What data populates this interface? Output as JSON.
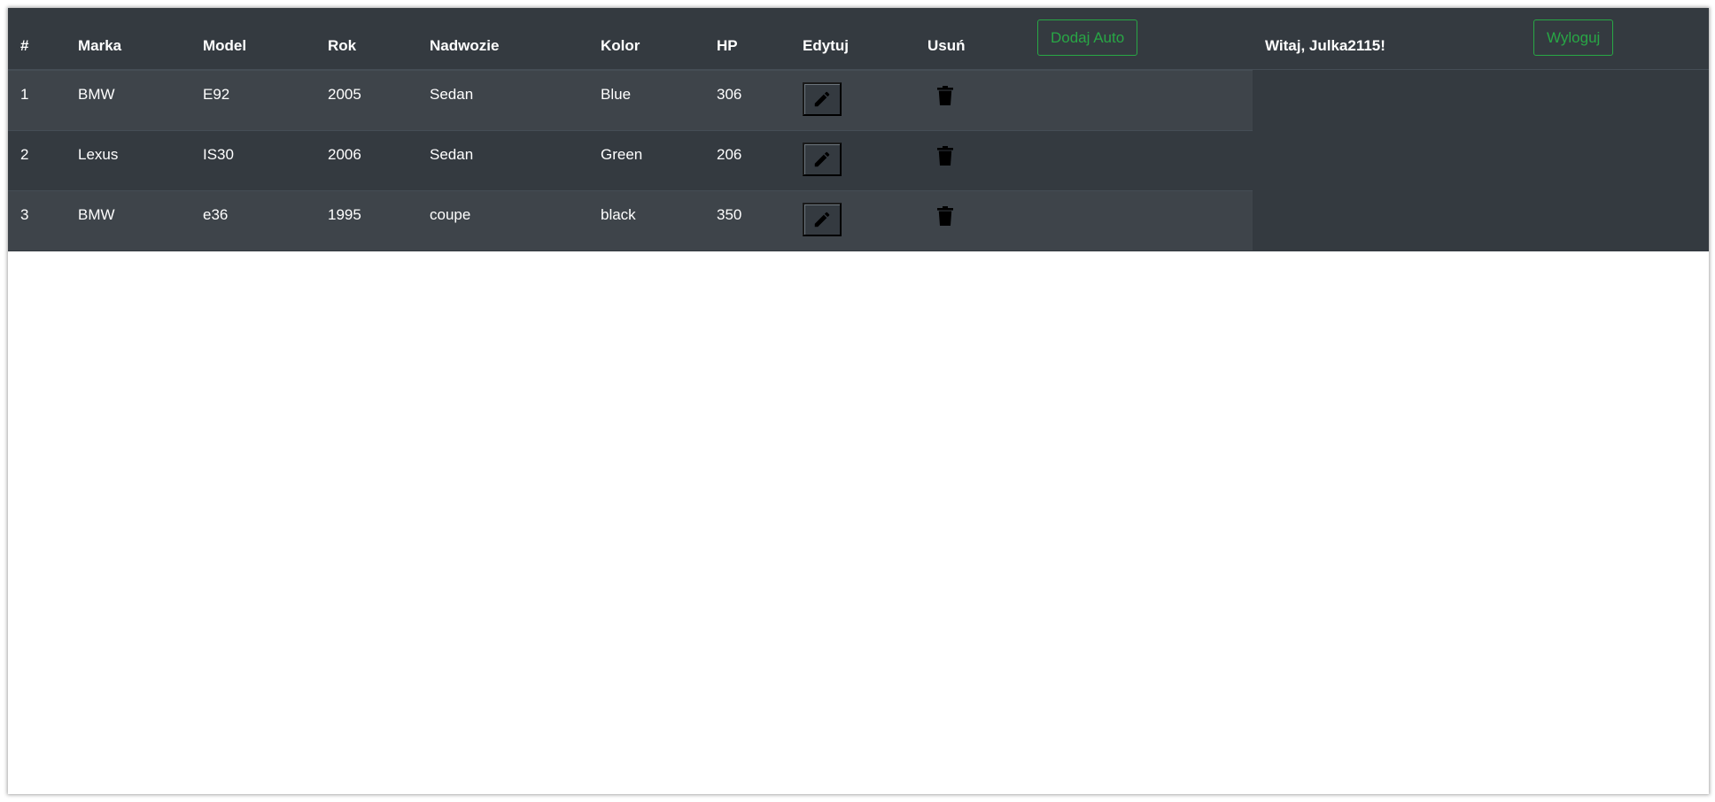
{
  "table": {
    "headers": {
      "num": "#",
      "make": "Marka",
      "model": "Model",
      "year": "Rok",
      "body": "Nadwozie",
      "color": "Kolor",
      "hp": "HP",
      "edit": "Edytuj",
      "delete": "Usuń"
    },
    "rows": [
      {
        "num": "1",
        "make": "BMW",
        "model": "E92",
        "year": "2005",
        "body": "Sedan",
        "color": "Blue",
        "hp": "306"
      },
      {
        "num": "2",
        "make": "Lexus",
        "model": "IS30",
        "year": "2006",
        "body": "Sedan",
        "color": "Green",
        "hp": "206"
      },
      {
        "num": "3",
        "make": "BMW",
        "model": "e36",
        "year": "1995",
        "body": "coupe",
        "color": "black",
        "hp": "350"
      }
    ]
  },
  "header": {
    "add_car_label": "Dodaj Auto",
    "welcome_text": "Witaj, Julka2115!",
    "logout_label": "Wyloguj"
  },
  "icons": {
    "edit": "pencil-icon",
    "delete": "trash-icon"
  },
  "colors": {
    "dark_bg": "#343a40",
    "striped_row": "#3e444a",
    "success": "#28a745"
  }
}
